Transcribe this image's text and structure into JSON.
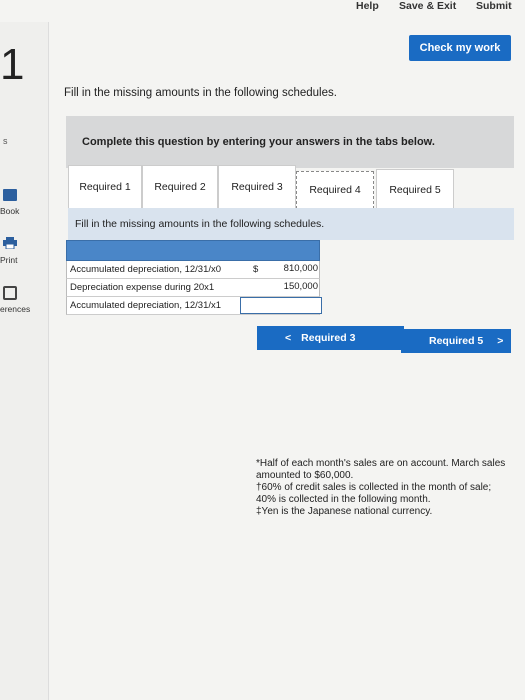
{
  "topbar": {
    "help": "Help",
    "save_exit": "Save & Exit",
    "submit": "Submit"
  },
  "check_work": "Check my work",
  "question_number": "1",
  "sidebar": {
    "fragment": "s",
    "book": "Book",
    "print": "Print",
    "references": "erences"
  },
  "instruction": "Fill in the missing amounts in the following schedules.",
  "panel_title": "Complete this question by entering your answers in the tabs below.",
  "tabs": [
    {
      "label": "Required 1"
    },
    {
      "label": "Required 2"
    },
    {
      "label": "Required 3"
    },
    {
      "label": "Required 4"
    },
    {
      "label": "Required 5"
    }
  ],
  "active_tab": "Required 4",
  "sub_instruction": "Fill in the missing amounts in the following schedules.",
  "schedule": {
    "rows": [
      {
        "label": "Accumulated depreciation, 12/31/x0",
        "currency": "$",
        "value": "810,000"
      },
      {
        "label": "Depreciation expense during 20x1",
        "currency": "",
        "value": "150,000"
      },
      {
        "label": "Accumulated depreciation, 12/31/x1",
        "currency": "",
        "value": ""
      }
    ]
  },
  "nav": {
    "prev_label": "Required 3",
    "prev_arrow": "<",
    "next_label": "Required 5",
    "next_arrow": ">"
  },
  "footnotes": [
    "*Half of each month's sales are on account. March sales amounted to $60,000.",
    "†60% of credit sales is collected in the month of sale; 40% is collected in the following month.",
    "‡Yen is the Japanese national currency."
  ],
  "colors": {
    "accent": "#1a6bc3",
    "table_header": "#4a86c8",
    "panel": "#d7d8d9",
    "sub_panel": "#d9e3ee"
  }
}
